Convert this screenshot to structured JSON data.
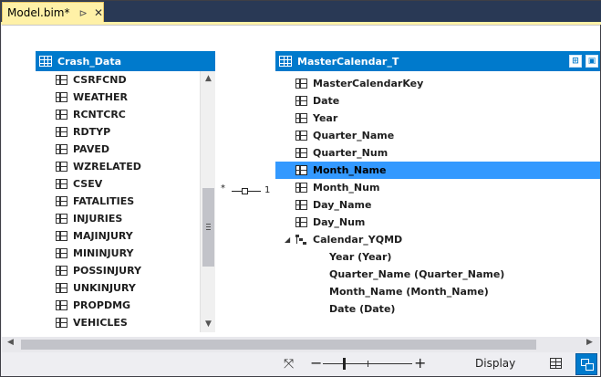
{
  "tab": {
    "title": "Model.bim*",
    "pin_glyph": "⊳",
    "close_glyph": "✕"
  },
  "colors": {
    "accent": "#007acc",
    "selection": "#3399ff",
    "tab_active": "#fff1a7",
    "chrome": "#293955"
  },
  "crash_table": {
    "title": "Crash_Data",
    "columns": [
      "CSRFCND",
      "WEATHER",
      "RCNTCRC",
      "RDTYP",
      "PAVED",
      "WZRELATED",
      "CSEV",
      "FATALITIES",
      "INJURIES",
      "MAJINJURY",
      "MININJURY",
      "POSSINJURY",
      "UNKINJURY",
      "PROPDMG",
      "VEHICLES"
    ]
  },
  "master_table": {
    "title": "MasterCalendar_T",
    "columns": [
      "MasterCalendarKey",
      "Date",
      "Year",
      "Quarter_Name",
      "Quarter_Num",
      "Month_Name",
      "Month_Num",
      "Day_Name",
      "Day_Num"
    ],
    "selected_column": "Month_Name",
    "hierarchy": {
      "name": "Calendar_YQMD",
      "levels": [
        "Year (Year)",
        "Quarter_Name (Quarter_Name)",
        "Month_Name (Month_Name)",
        "Date (Date)"
      ]
    }
  },
  "relationship": {
    "many": "*",
    "one": "1"
  },
  "status": {
    "display_label": "Display",
    "zoom_minus": "−",
    "zoom_plus": "+",
    "zoom_percent": 0.22
  }
}
